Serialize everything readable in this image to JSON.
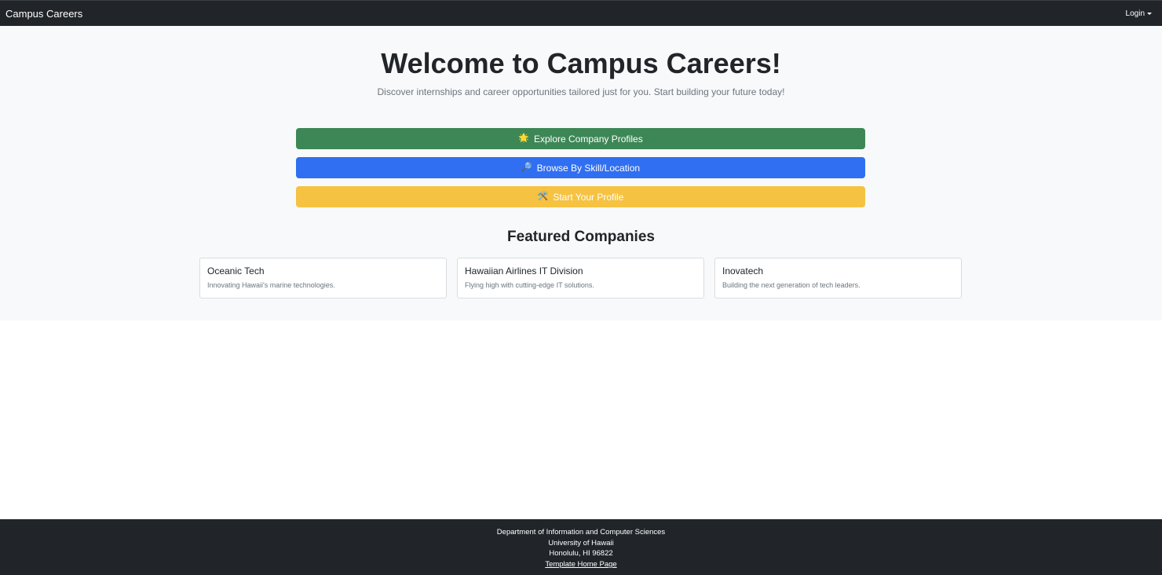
{
  "navbar": {
    "brand": "Campus Careers",
    "login_label": "Login"
  },
  "hero": {
    "title": "Welcome to Campus Careers!",
    "subtitle": "Discover internships and career opportunities tailored just for you. Start building your future today!"
  },
  "actions": [
    {
      "icon": "🌟",
      "label": "Explore Company Profiles",
      "color": "#3d8756"
    },
    {
      "icon": "🔎",
      "label": "Browse By Skill/Location",
      "color": "#306ff1"
    },
    {
      "icon": "🛠️",
      "label": "Start Your Profile",
      "color": "#f5c242"
    }
  ],
  "featured": {
    "title": "Featured Companies",
    "companies": [
      {
        "name": "Oceanic Tech",
        "description": "Innovating Hawaii's marine technologies."
      },
      {
        "name": "Hawaiian Airlines IT Division",
        "description": "Flying high with cutting-edge IT solutions."
      },
      {
        "name": "Inovatech",
        "description": "Building the next generation of tech leaders."
      }
    ]
  },
  "footer": {
    "line1": "Department of Information and Computer Sciences",
    "line2": "University of Hawaii",
    "line3": "Honolulu, HI 96822",
    "link": "Template Home Page"
  }
}
